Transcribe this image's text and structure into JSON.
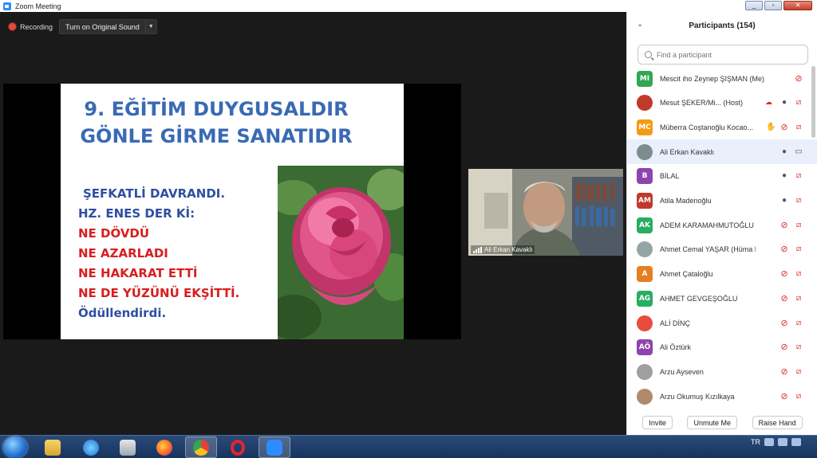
{
  "window": {
    "title": "Zoom Meeting"
  },
  "toolbar": {
    "recording_label": "Recording",
    "original_sound_label": "Turn on Original Sound"
  },
  "slide": {
    "title_line1": "9. EĞİTİM DUYGUSALDIR",
    "title_line2": "GÖNLE GİRME SANATIDIR",
    "lines": [
      {
        "text": "ŞEFKATLİ DAVRANDI.",
        "color": "blue"
      },
      {
        "text": "HZ. ENES DER Kİ:",
        "color": "blue"
      },
      {
        "text": "NE DÖVDÜ",
        "color": "red"
      },
      {
        "text": "NE AZARLADI",
        "color": "red"
      },
      {
        "text": "NE HAKARAT ETTİ",
        "color": "red"
      },
      {
        "text": "NE DE YÜZÜNÜ EKŞİTTİ.",
        "color": "red"
      },
      {
        "text": "Ödüllendirdi.",
        "color": "blue"
      }
    ]
  },
  "video": {
    "speaker_name": "Ali Erkan Kavaklı"
  },
  "participants_panel": {
    "title": "Participants (154)",
    "search_placeholder": "Find a participant",
    "participants": [
      {
        "initials": "MI",
        "avatar_color": "#2fa84f",
        "name": "Mescit iho Zeynep ŞIŞMAN (Me)",
        "mic": "off",
        "cam": "none"
      },
      {
        "initials": "",
        "avatar_color": "#c0392b",
        "avatar_icon": "emblem-icon",
        "name": "Mesut ŞEKER/Mi...",
        "suffix": "(Host)",
        "mic": "on",
        "cam": "off"
      },
      {
        "initials": "MC",
        "avatar_color": "#f39c12",
        "name": "Müberra Coştanoğlu Kocao...",
        "hand": true,
        "mic": "off",
        "cam": "off"
      },
      {
        "initials": "",
        "avatar_color": "#7f8c8d",
        "avatar_icon": "photo-icon",
        "name": "Ali Erkan Kavaklı",
        "mic": "on",
        "cam": "on",
        "highlight": true
      },
      {
        "initials": "B",
        "avatar_color": "#8e44ad",
        "name": "BİLAL",
        "mic": "on",
        "cam": "off"
      },
      {
        "initials": "AM",
        "avatar_color": "#c0392b",
        "name": "Atila Madenoğlu",
        "mic": "on",
        "cam": "off"
      },
      {
        "initials": "AK",
        "avatar_color": "#27ae60",
        "name": "ADEM KARAMAHMUTOĞLU",
        "mic": "off",
        "cam": "off"
      },
      {
        "initials": "",
        "avatar_color": "#95a5a6",
        "avatar_icon": "photo-icon",
        "name": "Ahmet Cemal YAŞAR (Hüma Hat...",
        "mic": "off",
        "cam": "off"
      },
      {
        "initials": "A",
        "avatar_color": "#e67e22",
        "name": "Ahmet Çataloğlu",
        "mic": "off",
        "cam": "off"
      },
      {
        "initials": "AG",
        "avatar_color": "#27ae60",
        "name": "AHMET GEVGEŞOĞLU",
        "mic": "off",
        "cam": "off"
      },
      {
        "initials": "",
        "avatar_color": "#e74c3c",
        "avatar_icon": "question-icon",
        "name": "ALİ DİNÇ",
        "mic": "off",
        "cam": "off"
      },
      {
        "initials": "AÖ",
        "avatar_color": "#8e44ad",
        "name": "Ali Öztürk",
        "mic": "off",
        "cam": "off"
      },
      {
        "initials": "",
        "avatar_color": "#a0a0a0",
        "avatar_icon": "photo-icon",
        "name": "Arzu Ayseven",
        "mic": "off",
        "cam": "off"
      },
      {
        "initials": "",
        "avatar_color": "#b08a6a",
        "avatar_icon": "photo-icon",
        "name": "Arzu Okumuş Kızılkaya",
        "mic": "off",
        "cam": "off"
      }
    ],
    "footer": {
      "invite": "Invite",
      "unmute_me": "Unmute Me",
      "raise_hand": "Raise Hand"
    }
  },
  "taskbar": {
    "language": "TR"
  }
}
